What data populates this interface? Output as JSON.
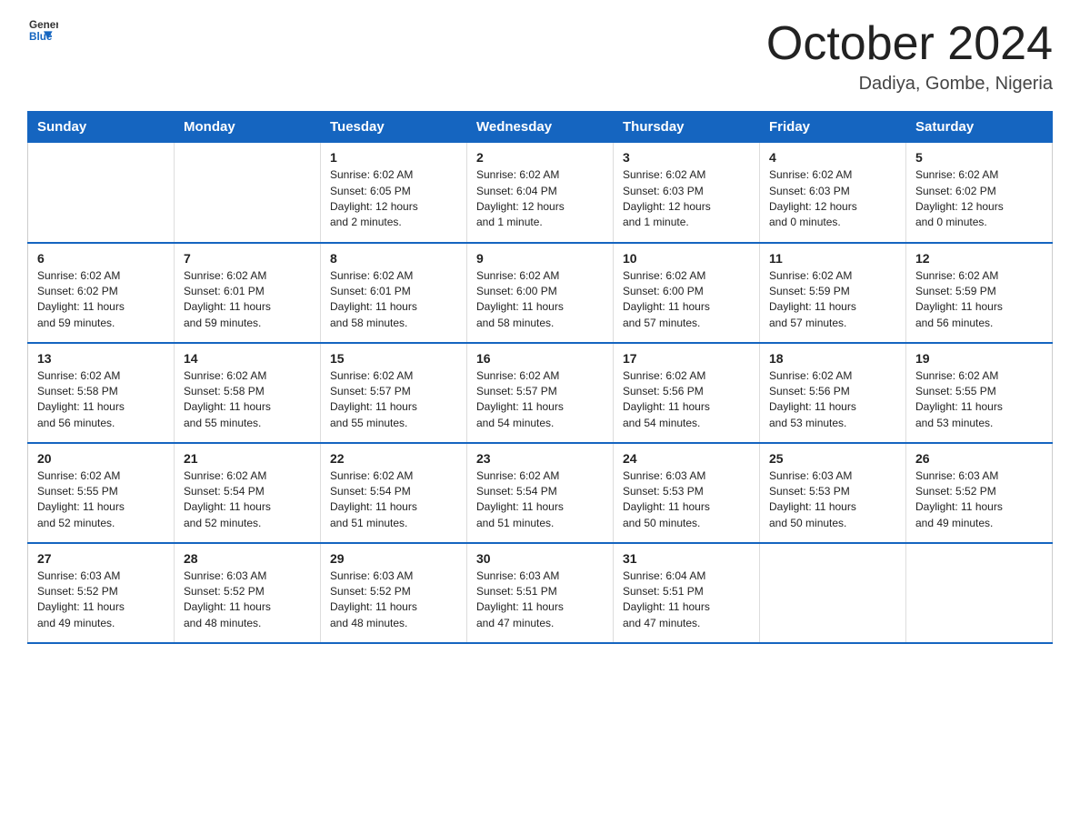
{
  "header": {
    "logo_general": "General",
    "logo_blue": "Blue",
    "month_title": "October 2024",
    "location": "Dadiya, Gombe, Nigeria"
  },
  "calendar": {
    "weekdays": [
      "Sunday",
      "Monday",
      "Tuesday",
      "Wednesday",
      "Thursday",
      "Friday",
      "Saturday"
    ],
    "weeks": [
      [
        {
          "day": "",
          "info": ""
        },
        {
          "day": "",
          "info": ""
        },
        {
          "day": "1",
          "info": "Sunrise: 6:02 AM\nSunset: 6:05 PM\nDaylight: 12 hours\nand 2 minutes."
        },
        {
          "day": "2",
          "info": "Sunrise: 6:02 AM\nSunset: 6:04 PM\nDaylight: 12 hours\nand 1 minute."
        },
        {
          "day": "3",
          "info": "Sunrise: 6:02 AM\nSunset: 6:03 PM\nDaylight: 12 hours\nand 1 minute."
        },
        {
          "day": "4",
          "info": "Sunrise: 6:02 AM\nSunset: 6:03 PM\nDaylight: 12 hours\nand 0 minutes."
        },
        {
          "day": "5",
          "info": "Sunrise: 6:02 AM\nSunset: 6:02 PM\nDaylight: 12 hours\nand 0 minutes."
        }
      ],
      [
        {
          "day": "6",
          "info": "Sunrise: 6:02 AM\nSunset: 6:02 PM\nDaylight: 11 hours\nand 59 minutes."
        },
        {
          "day": "7",
          "info": "Sunrise: 6:02 AM\nSunset: 6:01 PM\nDaylight: 11 hours\nand 59 minutes."
        },
        {
          "day": "8",
          "info": "Sunrise: 6:02 AM\nSunset: 6:01 PM\nDaylight: 11 hours\nand 58 minutes."
        },
        {
          "day": "9",
          "info": "Sunrise: 6:02 AM\nSunset: 6:00 PM\nDaylight: 11 hours\nand 58 minutes."
        },
        {
          "day": "10",
          "info": "Sunrise: 6:02 AM\nSunset: 6:00 PM\nDaylight: 11 hours\nand 57 minutes."
        },
        {
          "day": "11",
          "info": "Sunrise: 6:02 AM\nSunset: 5:59 PM\nDaylight: 11 hours\nand 57 minutes."
        },
        {
          "day": "12",
          "info": "Sunrise: 6:02 AM\nSunset: 5:59 PM\nDaylight: 11 hours\nand 56 minutes."
        }
      ],
      [
        {
          "day": "13",
          "info": "Sunrise: 6:02 AM\nSunset: 5:58 PM\nDaylight: 11 hours\nand 56 minutes."
        },
        {
          "day": "14",
          "info": "Sunrise: 6:02 AM\nSunset: 5:58 PM\nDaylight: 11 hours\nand 55 minutes."
        },
        {
          "day": "15",
          "info": "Sunrise: 6:02 AM\nSunset: 5:57 PM\nDaylight: 11 hours\nand 55 minutes."
        },
        {
          "day": "16",
          "info": "Sunrise: 6:02 AM\nSunset: 5:57 PM\nDaylight: 11 hours\nand 54 minutes."
        },
        {
          "day": "17",
          "info": "Sunrise: 6:02 AM\nSunset: 5:56 PM\nDaylight: 11 hours\nand 54 minutes."
        },
        {
          "day": "18",
          "info": "Sunrise: 6:02 AM\nSunset: 5:56 PM\nDaylight: 11 hours\nand 53 minutes."
        },
        {
          "day": "19",
          "info": "Sunrise: 6:02 AM\nSunset: 5:55 PM\nDaylight: 11 hours\nand 53 minutes."
        }
      ],
      [
        {
          "day": "20",
          "info": "Sunrise: 6:02 AM\nSunset: 5:55 PM\nDaylight: 11 hours\nand 52 minutes."
        },
        {
          "day": "21",
          "info": "Sunrise: 6:02 AM\nSunset: 5:54 PM\nDaylight: 11 hours\nand 52 minutes."
        },
        {
          "day": "22",
          "info": "Sunrise: 6:02 AM\nSunset: 5:54 PM\nDaylight: 11 hours\nand 51 minutes."
        },
        {
          "day": "23",
          "info": "Sunrise: 6:02 AM\nSunset: 5:54 PM\nDaylight: 11 hours\nand 51 minutes."
        },
        {
          "day": "24",
          "info": "Sunrise: 6:03 AM\nSunset: 5:53 PM\nDaylight: 11 hours\nand 50 minutes."
        },
        {
          "day": "25",
          "info": "Sunrise: 6:03 AM\nSunset: 5:53 PM\nDaylight: 11 hours\nand 50 minutes."
        },
        {
          "day": "26",
          "info": "Sunrise: 6:03 AM\nSunset: 5:52 PM\nDaylight: 11 hours\nand 49 minutes."
        }
      ],
      [
        {
          "day": "27",
          "info": "Sunrise: 6:03 AM\nSunset: 5:52 PM\nDaylight: 11 hours\nand 49 minutes."
        },
        {
          "day": "28",
          "info": "Sunrise: 6:03 AM\nSunset: 5:52 PM\nDaylight: 11 hours\nand 48 minutes."
        },
        {
          "day": "29",
          "info": "Sunrise: 6:03 AM\nSunset: 5:52 PM\nDaylight: 11 hours\nand 48 minutes."
        },
        {
          "day": "30",
          "info": "Sunrise: 6:03 AM\nSunset: 5:51 PM\nDaylight: 11 hours\nand 47 minutes."
        },
        {
          "day": "31",
          "info": "Sunrise: 6:04 AM\nSunset: 5:51 PM\nDaylight: 11 hours\nand 47 minutes."
        },
        {
          "day": "",
          "info": ""
        },
        {
          "day": "",
          "info": ""
        }
      ]
    ]
  }
}
